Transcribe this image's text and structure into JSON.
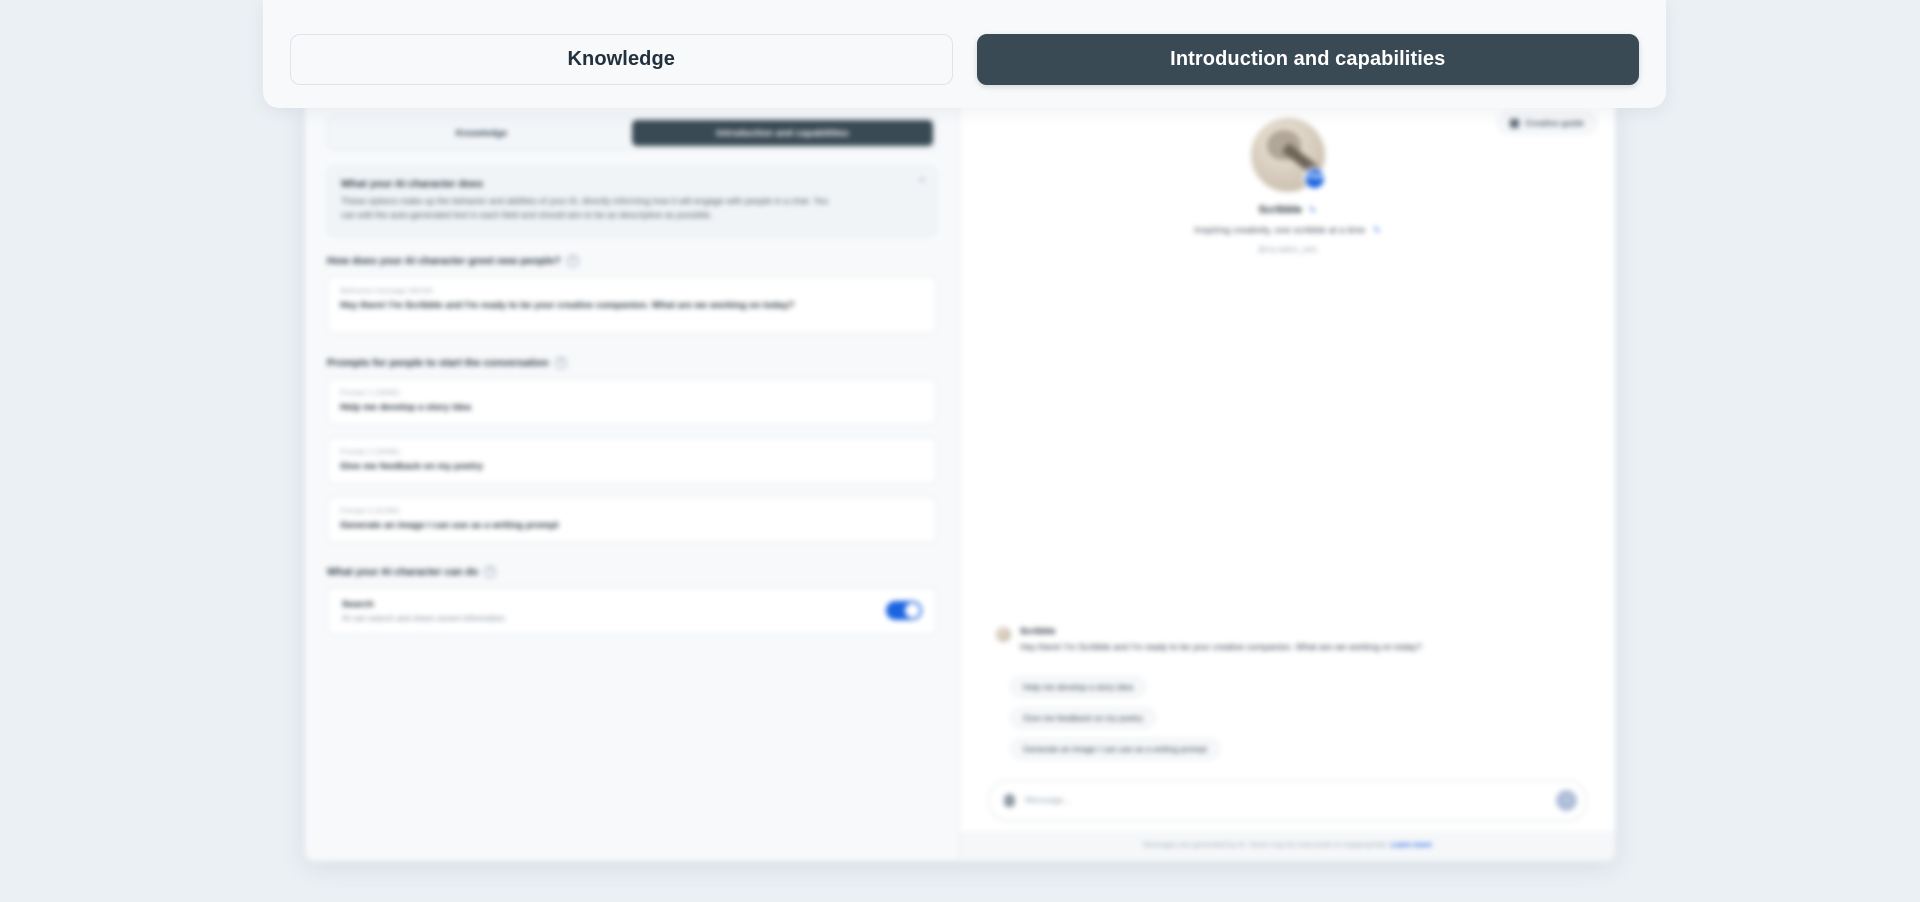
{
  "background_color": "#eaf0f4",
  "accent_color": "#1a64e0",
  "dark_tab_color": "#3a4a55",
  "overlay_tabs": [
    {
      "label": "Knowledge",
      "active": false
    },
    {
      "label": "Introduction and capabilities",
      "active": true
    }
  ],
  "editor": {
    "mini_tabs": [
      {
        "label": "Knowledge",
        "active": false
      },
      {
        "label": "Introduction and capabilities",
        "active": true
      }
    ],
    "info_card": {
      "title": "What your AI character does",
      "body": "These options make up the behavior and abilities of your AI, directly informing how it will engage with people in a chat. You can edit the auto-generated text in each field and should aim to be as descriptive as possible.",
      "close_icon": "×"
    },
    "greeting_section": {
      "label": "How does your AI character greet new people?",
      "help_icon": "?",
      "input_sublabel": "Welcome message 99/200",
      "input_value": "Hey there! I'm Scribble and I'm ready to be your creative companion. What are we working on today?"
    },
    "prompts_section": {
      "label": "Prompts for people to start the conversation",
      "help_icon": "?",
      "prompts": [
        {
          "sublabel": "Prompt 1 (28/80)",
          "value": "Help me develop a story idea"
        },
        {
          "sublabel": "Prompt 2 (26/80)",
          "value": "Give me feedback on my poetry"
        },
        {
          "sublabel": "Prompt 3 (41/80)",
          "value": "Generate an image I can use as a writing prompt"
        }
      ]
    },
    "capabilities_section": {
      "label": "What your AI character can do",
      "help_icon": "?",
      "items": [
        {
          "name": "Search",
          "description": "AI can search and share recent information.",
          "enabled": true
        }
      ]
    }
  },
  "preview": {
    "guide_button": {
      "label": "Creative guide",
      "icon": "book-icon"
    },
    "persona": {
      "name": "Scribble",
      "edit_icon": "pencil-icon",
      "verified_icon": "check-icon",
      "tagline": "Inspiring creativity, one scribble at a time",
      "tagline_edit_icon": "pencil-icon",
      "handle": "@my.adam_sets"
    },
    "message": {
      "author": "Scribble",
      "text": "Hey there! I'm Scribble and I'm ready to be your creative companion. What are we working on today?"
    },
    "suggestion_chips": [
      "Help me develop a story idea",
      "Give me feedback on my poetry",
      "Generate an image I can use as a writing prompt"
    ],
    "composer": {
      "attach_icon": "paperclip-icon",
      "placeholder": "Message...",
      "send_icon": "↑"
    },
    "disclaimer": {
      "text": "Messages are generated by AI. Some may be inaccurate or inappropriate.",
      "link_label": "Learn more"
    }
  }
}
